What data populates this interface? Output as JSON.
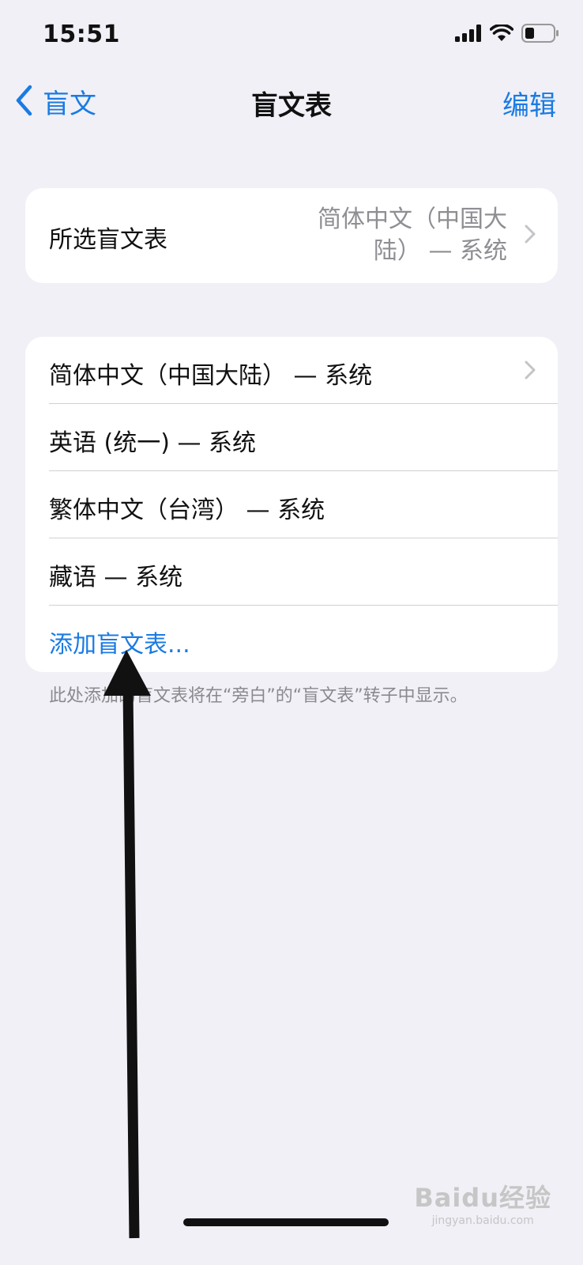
{
  "status_bar": {
    "time": "15:51",
    "icons": [
      "signal-icon",
      "wifi-icon",
      "battery-icon"
    ]
  },
  "nav": {
    "back_label": "盲文",
    "title": "盲文表",
    "edit_label": "编辑"
  },
  "selected_table": {
    "label": "所选盲文表",
    "value": "简体中文（中国大陆） — 系统"
  },
  "tables": [
    {
      "label": "简体中文（中国大陆） — 系统",
      "has_chevron": true
    },
    {
      "label": "英语 (统一) — 系统",
      "has_chevron": false
    },
    {
      "label": "繁体中文（台湾） — 系统",
      "has_chevron": false
    },
    {
      "label": "藏语 — 系统",
      "has_chevron": false
    }
  ],
  "add_table_label": "添加盲文表...",
  "footer_note": "此处添加的盲文表将在“旁白”的“盲文表”转子中显示。",
  "watermark": {
    "brand": "Baidu经验",
    "sub": "jingyan.baidu.com"
  },
  "colors": {
    "accent": "#1a7be3",
    "background": "#f0f0f6",
    "secondary_text": "#8e8e93"
  }
}
